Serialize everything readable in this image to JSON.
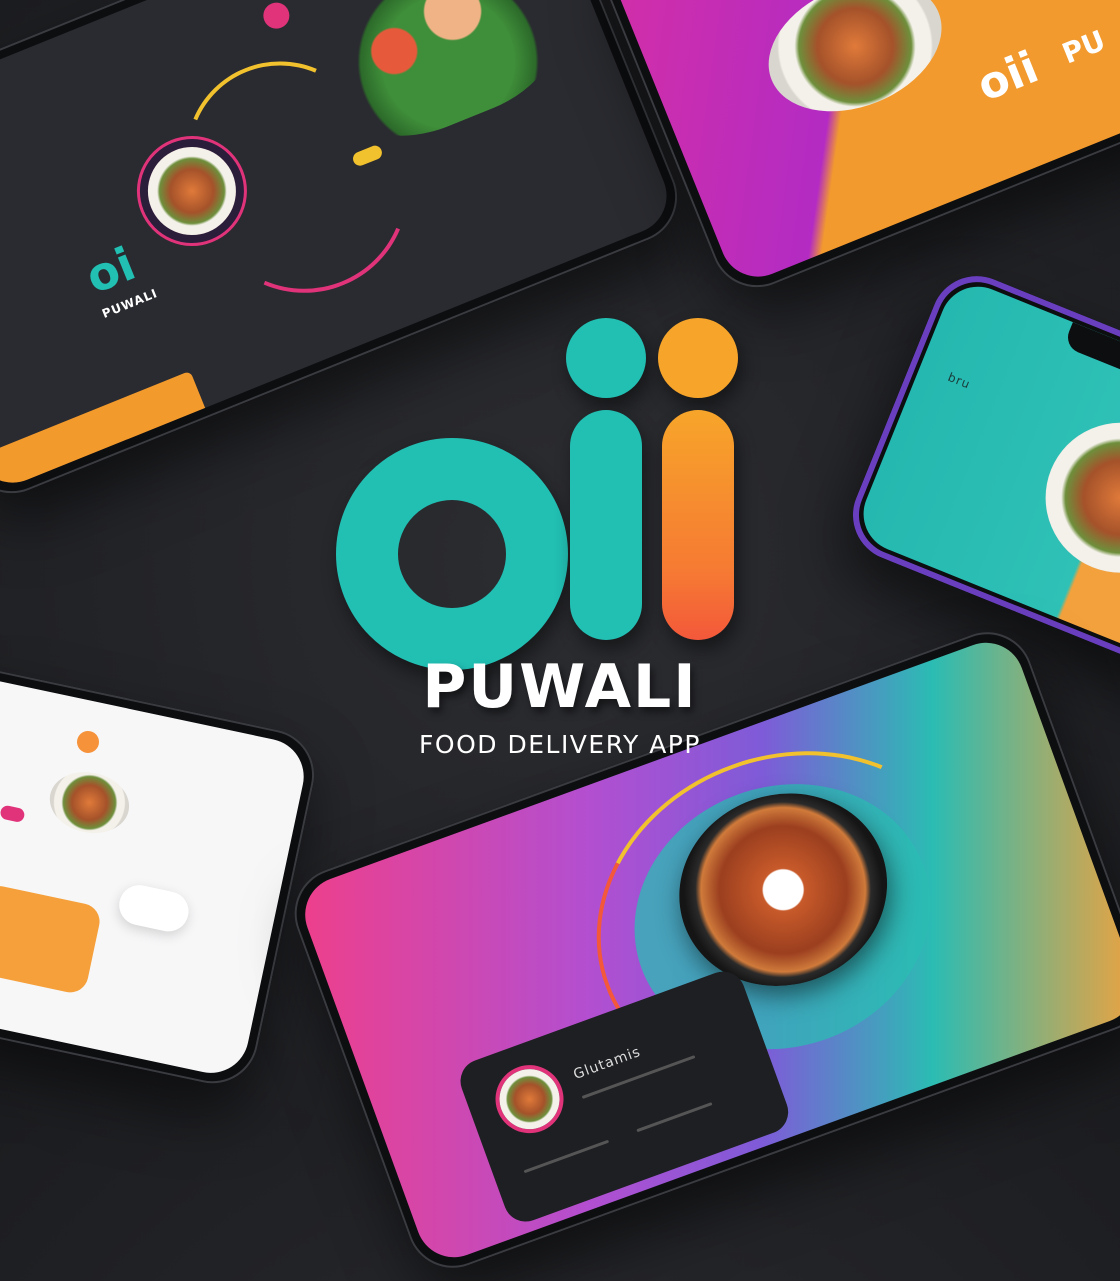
{
  "brand": {
    "name": "PUWALI",
    "tagline": "FOOD DELIVERY APP",
    "logo_mark": "oii"
  },
  "phones": {
    "top_left": {
      "logo_mark": "oi",
      "logo_text": "PUWALI"
    },
    "top_right": {
      "logo_mark": "oii",
      "partial_text": "PU"
    },
    "right": {
      "partial_text": "bru"
    },
    "bottom_right": {
      "card_title": "Glutamis"
    }
  },
  "colors": {
    "background": "#242529",
    "teal": "#22bfb3",
    "orange": "#f7a52a",
    "coral": "#f3583a",
    "magenta": "#d42fa6",
    "purple": "#7e5bd8"
  },
  "icons": [
    "food-plate-icon",
    "salad-icon",
    "noodle-bowl-icon",
    "status-icons"
  ]
}
